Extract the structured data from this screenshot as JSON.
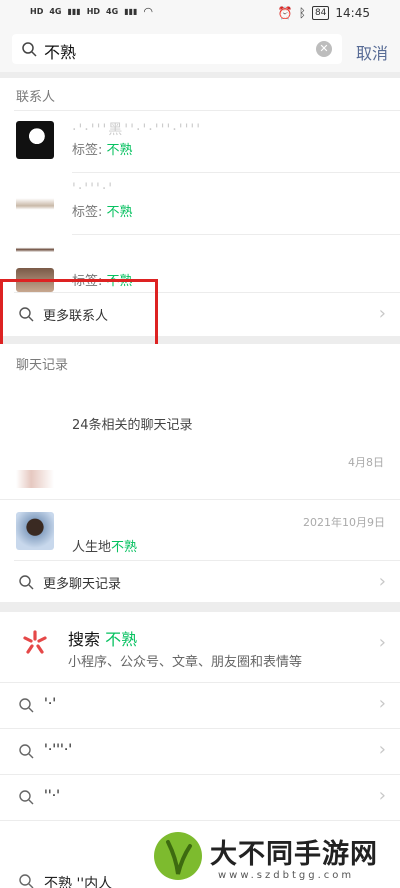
{
  "status_bar": {
    "network": [
      "HD",
      "4G",
      "HD",
      "4G"
    ],
    "battery": "84",
    "time": "14:45"
  },
  "search": {
    "query": "不熟",
    "cancel_label": "取消"
  },
  "contacts_section": {
    "title": "联系人",
    "tag_prefix": "标签: ",
    "tag_value": "不熟",
    "contacts": [
      {
        "name": "·'·'''黑''·'·'''·''''"
      },
      {
        "name": "'·'''·'"
      },
      {
        "name": ""
      },
      {
        "name": ""
      }
    ],
    "more_label": "更多联系人"
  },
  "chats_section": {
    "title": "聊天记录",
    "related_summary": "24条相关的聊天记录",
    "items": [
      {
        "date": "4月8日",
        "preview": ""
      },
      {
        "date": "2021年10月9日",
        "preview_prefix": "人生地",
        "preview_highlight": "不熟"
      }
    ],
    "more_label": "更多聊天记录"
  },
  "search_section": {
    "title_prefix": "搜索 ",
    "title_highlight": "不熟",
    "subtitle": "小程序、公众号、文章、朋友圈和表情等",
    "suggestions": [
      {
        "text": "'·'"
      },
      {
        "text": "'·'''·'"
      },
      {
        "text": "''·'"
      },
      {
        "text": "不熟 ''内人"
      }
    ]
  },
  "watermark": {
    "text": "大不同手游网",
    "url": "www.szdbtgg.com"
  },
  "colors": {
    "accent_green": "#07c160",
    "link_blue": "#576b95",
    "highlight_red": "#dd2222"
  }
}
